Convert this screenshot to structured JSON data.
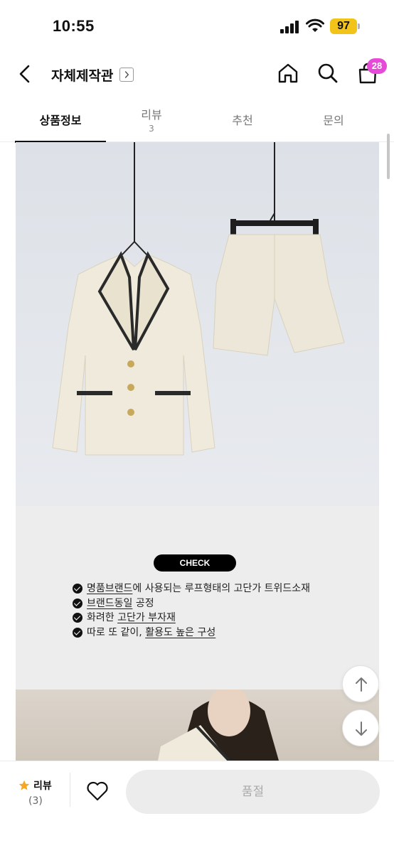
{
  "status_bar": {
    "time": "10:55",
    "battery": "97"
  },
  "header": {
    "shop_name": "자체제작관",
    "cart_count": "28"
  },
  "tabs": [
    {
      "label": "상품정보",
      "count": ""
    },
    {
      "label": "리뷰",
      "count": "3"
    },
    {
      "label": "추천",
      "count": ""
    },
    {
      "label": "문의",
      "count": ""
    }
  ],
  "check_section": {
    "pill": "CHECK",
    "items": [
      {
        "underlined": "명품브랜드",
        "rest": "에 사용되는 루프형태의 고단가 트위드소재"
      },
      {
        "underlined": "브랜드동일",
        "rest": " 공정"
      },
      {
        "prefix": "화려한 ",
        "underlined": "고단가 부자재"
      },
      {
        "prefix": "따로 또 같이, ",
        "underlined": "활용도 높은 구성"
      }
    ]
  },
  "bottom_bar": {
    "review_label": "리뷰",
    "review_count": "(3)",
    "soldout_label": "품절"
  },
  "colors": {
    "accent_badge": "#e64bd8",
    "battery": "#f2c41a",
    "star": "#f5a623"
  },
  "icons": [
    "back-chevron-icon",
    "home-icon",
    "search-icon",
    "shopping-bag-icon",
    "star-icon",
    "heart-icon",
    "arrow-up-icon",
    "arrow-down-icon"
  ]
}
